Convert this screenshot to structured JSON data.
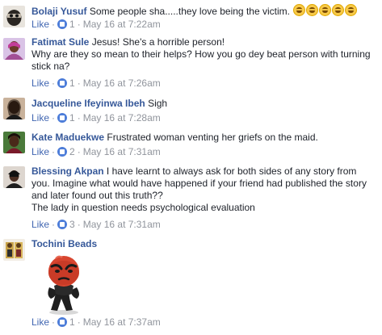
{
  "comments": [
    {
      "name": "Bolaji Yusuf",
      "text": "Some people sha.....they love being the victim.",
      "like": "Like",
      "dot": "·",
      "likes": "1",
      "time": "May 16 at 7:22am",
      "emoji_count": 5,
      "avatar_color": "#8a7a6a"
    },
    {
      "name": "Fatimat Sule",
      "text": "Jesus! She's a horrible person!",
      "text2": "Why are they so mean to their helps? How you go dey beat person with turning stick na?",
      "like": "Like",
      "dot": "·",
      "likes": "1",
      "time": "May 16 at 7:26am",
      "avatar_color": "#a05a8a"
    },
    {
      "name": "Jacqueline Ifeyinwa Ibeh",
      "text": "Sigh",
      "like": "Like",
      "dot": "·",
      "likes": "1",
      "time": "May 16 at 7:28am",
      "avatar_color": "#5a3a2a"
    },
    {
      "name": "Kate Maduekwe",
      "text": "Frustrated woman venting her griefs on the maid.",
      "like": "Like",
      "dot": "·",
      "likes": "2",
      "time": "May 16 at 7:31am",
      "avatar_color": "#6a4a3a"
    },
    {
      "name": "Blessing Akpan",
      "text": "I have learnt to always ask for both sides of any story from you. Imagine what would have happened if your friend had published the story and later found out this truth??",
      "text2": "The lady in question needs psychological evaluation",
      "like": "Like",
      "dot": "·",
      "likes": "3",
      "time": "May 16 at 7:31am",
      "avatar_color": "#3a2a2a"
    },
    {
      "name": "Tochini Beads",
      "like": "Like",
      "dot": "·",
      "likes": "1",
      "time": "May 16 at 7:37am",
      "avatar_color": "#b89a5a"
    }
  ],
  "colors": {
    "name": "#365899",
    "like": "#4267b2",
    "meta": "#90949c",
    "text": "#1d2129"
  }
}
